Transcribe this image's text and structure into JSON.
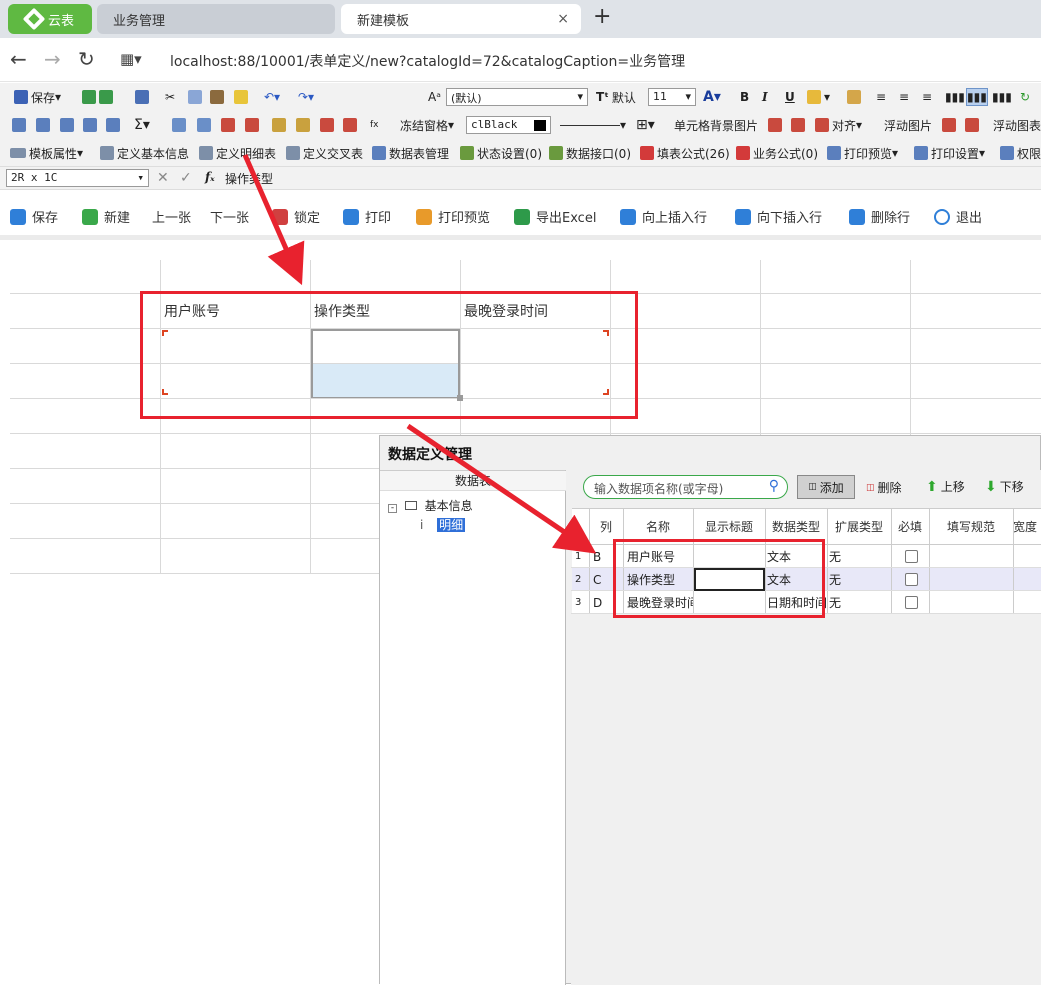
{
  "browser": {
    "tabs": [
      {
        "label": "云表"
      },
      {
        "label": "业务管理"
      },
      {
        "label": "新建模板"
      }
    ],
    "close_glyph": "×",
    "new_tab_glyph": "+",
    "url": "localhost:88/10001/表单定义/new?catalogId=72&catalogCaption=业务管理"
  },
  "toolbar1": {
    "save": "保存",
    "font_name": "(默认)",
    "font_style_label": "默认",
    "font_size": "11"
  },
  "toolbar2": {
    "freeze": "冻结窗格",
    "color_name": "clBlack",
    "cell_bg": "单元格背景图片",
    "align": "对齐",
    "float_image": "浮动图片",
    "float_chart": "浮动图表"
  },
  "toolbar3": {
    "items": [
      "模板属性",
      "定义基本信息",
      "定义明细表",
      "定义交叉表",
      "数据表管理",
      "状态设置(0)",
      "数据接口(0)",
      "填表公式(26)",
      "业务公式(0)",
      "打印预览",
      "打印设置",
      "权限"
    ]
  },
  "formula": {
    "cell_ref": "2R x 1C",
    "content": "操作类型"
  },
  "actions": [
    "保存",
    "新建",
    "上一张",
    "下一张",
    "锁定",
    "打印",
    "打印预览",
    "导出Excel",
    "向上插入行",
    "向下插入行",
    "删除行",
    "退出"
  ],
  "sheet": {
    "headers": [
      "用户账号",
      "操作类型",
      "最晚登录时间"
    ]
  },
  "dialog": {
    "title": "数据定义管理",
    "tree_header": "数据表",
    "tree_root": "基本信息",
    "tree_child": "明细",
    "search_placeholder": "输入数据项名称(或字母)",
    "add": "添加",
    "delete": "删除",
    "up": "上移",
    "down": "下移",
    "columns": [
      "列",
      "名称",
      "显示标题",
      "数据类型",
      "扩展类型",
      "必填",
      "填写规范",
      "宽度"
    ],
    "rows": [
      {
        "num": "1",
        "col": "B",
        "name": "用户账号",
        "title": "",
        "type": "文本",
        "ext": "无"
      },
      {
        "num": "2",
        "col": "C",
        "name": "操作类型",
        "title": "",
        "type": "文本",
        "ext": "无"
      },
      {
        "num": "3",
        "col": "D",
        "name": "最晚登录时间",
        "title": "",
        "type": "日期和时间",
        "ext": "无"
      }
    ]
  },
  "colors": {
    "accent_green": "#5fb942",
    "annotation_red": "#e8222e",
    "selection_blue": "#d9eaf7"
  }
}
